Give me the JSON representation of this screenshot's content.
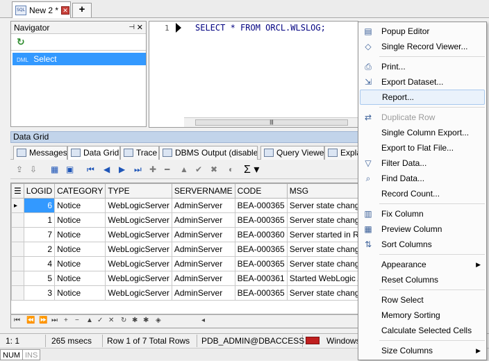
{
  "tabs": [
    {
      "label": "New 2 *"
    }
  ],
  "navigator": {
    "title": "Navigator",
    "item": "Select",
    "item_prefix": "DML"
  },
  "editor": {
    "line": "1",
    "sql": "SELECT * FROM ORCL.WLSLOG;"
  },
  "datagrid": {
    "title": "Data Grid",
    "tabs": [
      "Messages",
      "Data Grid",
      "Trace",
      "DBMS Output (disabled)",
      "Query Viewer",
      "Expla"
    ],
    "columns": [
      "LOGID",
      "CATEGORY",
      "TYPE",
      "SERVERNAME",
      "CODE",
      "MSG"
    ],
    "rows": [
      [
        "6",
        "Notice",
        "WebLogicServer",
        "AdminServer",
        "BEA-000365",
        "Server state change"
      ],
      [
        "1",
        "Notice",
        "WebLogicServer",
        "AdminServer",
        "BEA-000365",
        "Server state change"
      ],
      [
        "7",
        "Notice",
        "WebLogicServer",
        "AdminServer",
        "BEA-000360",
        "Server started in RU"
      ],
      [
        "2",
        "Notice",
        "WebLogicServer",
        "AdminServer",
        "BEA-000365",
        "Server state change"
      ],
      [
        "4",
        "Notice",
        "WebLogicServer",
        "AdminServer",
        "BEA-000365",
        "Server state change"
      ],
      [
        "5",
        "Notice",
        "WebLogicServer",
        "AdminServer",
        "BEA-000361",
        "Started WebLogic A"
      ],
      [
        "3",
        "Notice",
        "WebLogicServer",
        "AdminServer",
        "BEA-000365",
        "Server state change"
      ]
    ]
  },
  "status": {
    "position": "1:   1",
    "time": "265 msecs",
    "rows": "Row 1 of 7 Total Rows",
    "connection": "PDB_ADMIN@DBACCESS",
    "auth": "Windows",
    "num": "NUM",
    "ins": "INS"
  },
  "context_menu": [
    {
      "label": "Popup Editor",
      "icon": "popup-editor-icon"
    },
    {
      "label": "Single Record Viewer...",
      "icon": "record-viewer-icon"
    },
    {
      "sep": true
    },
    {
      "label": "Print...",
      "icon": "print-icon"
    },
    {
      "label": "Export Dataset...",
      "icon": "export-icon"
    },
    {
      "label": "Report...",
      "hover": true
    },
    {
      "sep": true
    },
    {
      "label": "Duplicate Row",
      "icon": "duplicate-icon",
      "disabled": true
    },
    {
      "label": "Single Column Export..."
    },
    {
      "label": "Export to Flat File..."
    },
    {
      "label": "Filter Data...",
      "icon": "filter-icon"
    },
    {
      "label": "Find Data...",
      "icon": "find-icon"
    },
    {
      "label": "Record Count..."
    },
    {
      "sep": true
    },
    {
      "label": "Fix Column",
      "icon": "fix-column-icon"
    },
    {
      "label": "Preview Column",
      "icon": "preview-column-icon"
    },
    {
      "label": "Sort Columns",
      "icon": "sort-columns-icon"
    },
    {
      "sep": true
    },
    {
      "label": "Appearance",
      "submenu": true
    },
    {
      "label": "Reset Columns"
    },
    {
      "sep": true
    },
    {
      "label": "Row Select"
    },
    {
      "label": "Memory Sorting"
    },
    {
      "label": "Calculate Selected Cells"
    },
    {
      "sep": true
    },
    {
      "label": "Size Columns",
      "submenu": true
    }
  ]
}
